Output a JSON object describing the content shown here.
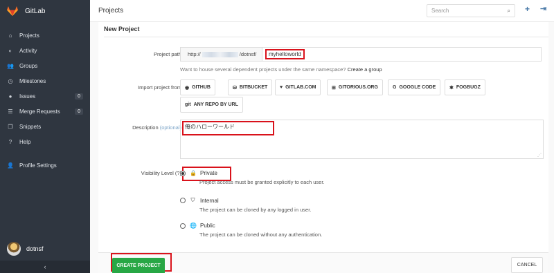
{
  "app": {
    "name": "GitLab"
  },
  "sidebar": {
    "items": [
      {
        "label": "Projects",
        "icon": "home-icon",
        "glyph": "⌂"
      },
      {
        "label": "Activity",
        "icon": "dashboard-icon",
        "glyph": "◐"
      },
      {
        "label": "Groups",
        "icon": "group-icon",
        "glyph": "👥"
      },
      {
        "label": "Milestones",
        "icon": "clock-icon",
        "glyph": "◷"
      },
      {
        "label": "Issues",
        "icon": "exclamation-icon",
        "glyph": "●",
        "count": "0"
      },
      {
        "label": "Merge Requests",
        "icon": "list-icon",
        "glyph": "☰",
        "count": "0"
      },
      {
        "label": "Snippets",
        "icon": "copy-icon",
        "glyph": "❐"
      },
      {
        "label": "Help",
        "icon": "question-icon",
        "glyph": "?"
      }
    ],
    "profile_settings": {
      "label": "Profile Settings",
      "icon": "user-icon",
      "glyph": "👤"
    },
    "user": {
      "name": "dotnsf"
    },
    "collapse_glyph": "‹"
  },
  "header": {
    "title": "Projects",
    "search": {
      "placeholder": "Search"
    },
    "plus_glyph": "+",
    "signout_glyph": "⇥"
  },
  "form": {
    "title": "New Project",
    "project_path": {
      "label": "Project path",
      "prefix_start": "http://",
      "prefix_end": "/dotnsf/",
      "value": "myhelloworld"
    },
    "hint_text": "Want to house several dependent projects under the same namespace?",
    "hint_link": "Create a group",
    "import_label": "Import project from",
    "import_sources": [
      {
        "label": "GITHUB",
        "icon": "github-icon",
        "glyph": "◉"
      },
      {
        "label": "BITBUCKET",
        "icon": "bitbucket-icon",
        "glyph": "⛁"
      },
      {
        "label": "GITLAB.COM",
        "icon": "heart-icon",
        "glyph": "♥"
      },
      {
        "label": "GITORIOUS.ORG",
        "icon": "gitorious-icon",
        "glyph": "⊞"
      },
      {
        "label": "GOOGLE CODE",
        "icon": "google-icon",
        "glyph": "G"
      },
      {
        "label": "FOGBUGZ",
        "icon": "bug-icon",
        "glyph": "✱"
      },
      {
        "label": "ANY REPO BY URL",
        "icon": "git-icon",
        "glyph": "git"
      }
    ],
    "description": {
      "label": "Description",
      "optional": "(optional)",
      "value": "俺のハローワールド"
    },
    "visibility": {
      "label": "Visibility Level (?)",
      "options": [
        {
          "name": "Private",
          "icon": "lock-icon",
          "glyph": "🔒",
          "desc": "Project access must be granted explicitly to each user.",
          "checked": true
        },
        {
          "name": "Internal",
          "icon": "shield-icon",
          "glyph": "⛉",
          "desc": "The project can be cloned by any logged in user.",
          "checked": false
        },
        {
          "name": "Public",
          "icon": "globe-icon",
          "glyph": "🌐",
          "desc": "The project can be cloned without any authentication.",
          "checked": false
        }
      ]
    },
    "create_button": "CREATE PROJECT",
    "cancel_button": "CANCEL"
  },
  "colors": {
    "sidebar": "#2f3640",
    "accent": "#28a745",
    "highlight": "#d9121b",
    "logo": "#e24329"
  }
}
